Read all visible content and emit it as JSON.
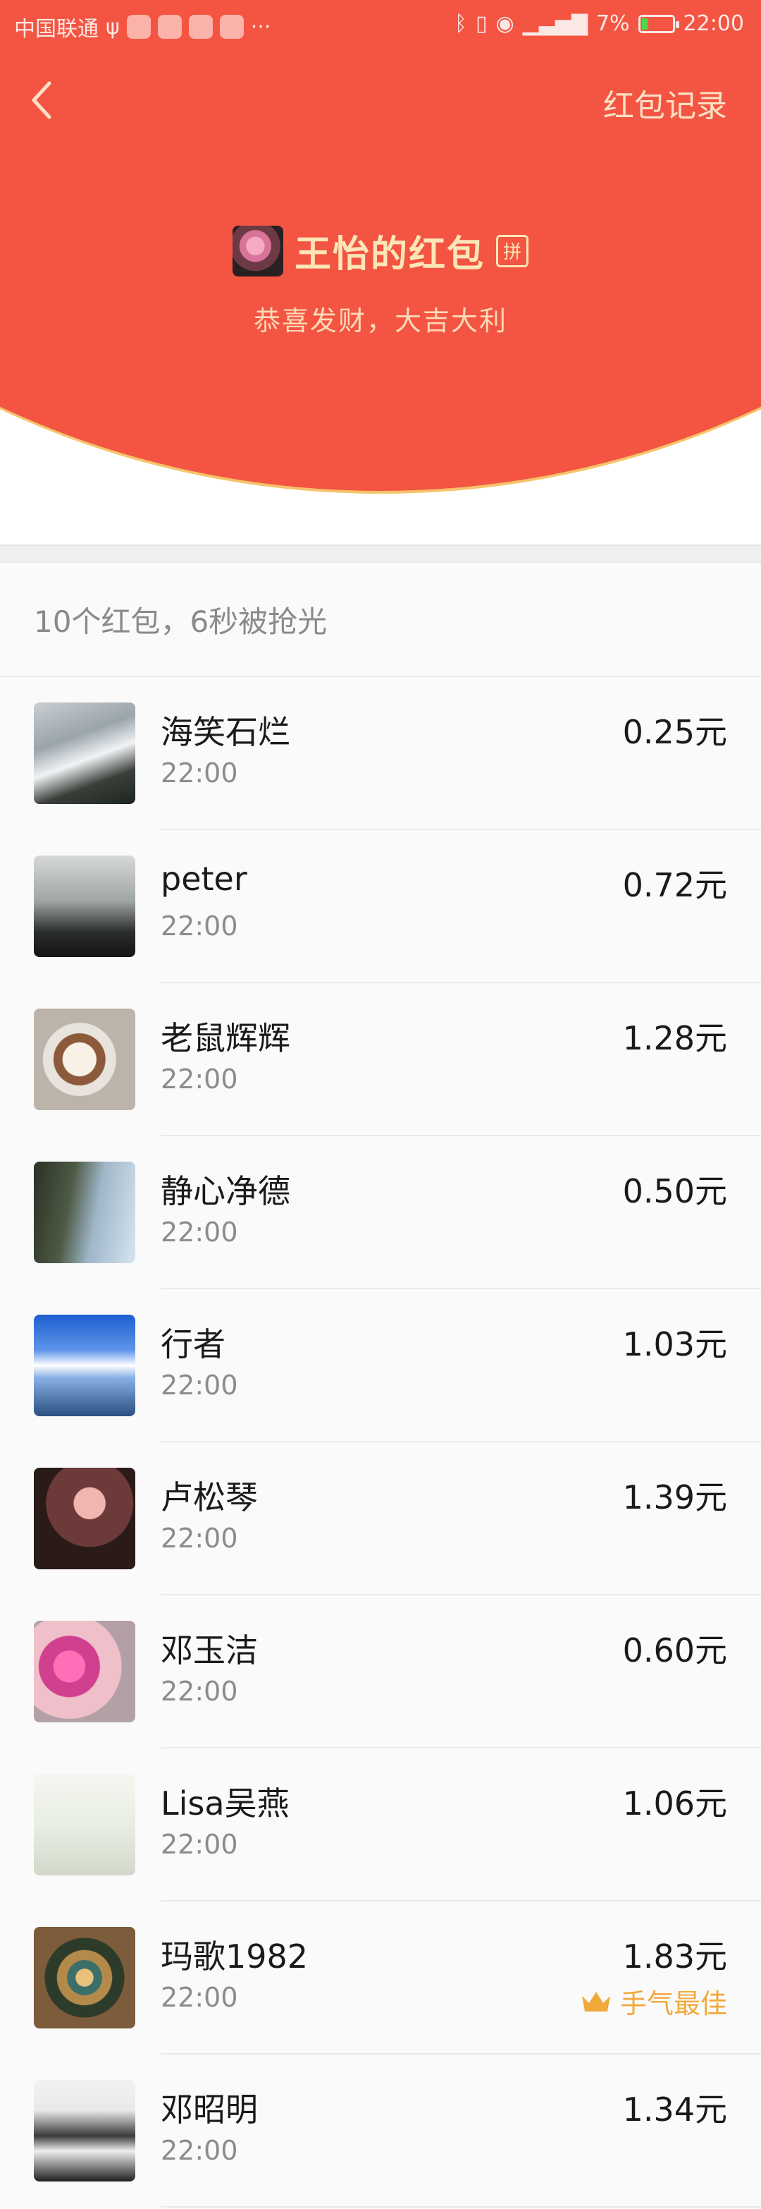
{
  "status_bar": {
    "carrier": "中国联通",
    "battery": "7%",
    "time": "22:00"
  },
  "header": {
    "records_label": "红包记录",
    "title": "王怡的红包",
    "pin_badge": "拼",
    "subtitle": "恭喜发财，大吉大利"
  },
  "summary": "10个红包，6秒被抢光",
  "colors": {
    "header_red": "#f35542",
    "gold_text": "#fce6b8",
    "best_luck": "#f1a93c"
  },
  "records": [
    {
      "name": "海笑石烂",
      "time": "22:00",
      "amount": "0.25元"
    },
    {
      "name": "peter",
      "time": "22:00",
      "amount": "0.72元"
    },
    {
      "name": "老鼠辉辉",
      "time": "22:00",
      "amount": "1.28元"
    },
    {
      "name": "静心净德",
      "time": "22:00",
      "amount": "0.50元"
    },
    {
      "name": "行者",
      "time": "22:00",
      "amount": "1.03元"
    },
    {
      "name": "卢松琴",
      "time": "22:00",
      "amount": "1.39元"
    },
    {
      "name": "邓玉洁",
      "time": "22:00",
      "amount": "0.60元"
    },
    {
      "name": "Lisa吴燕",
      "time": "22:00",
      "amount": "1.06元"
    },
    {
      "name": "玛歌1982",
      "time": "22:00",
      "amount": "1.83元",
      "badge": "手气最佳"
    },
    {
      "name": "邓昭明",
      "time": "22:00",
      "amount": "1.34元"
    }
  ]
}
